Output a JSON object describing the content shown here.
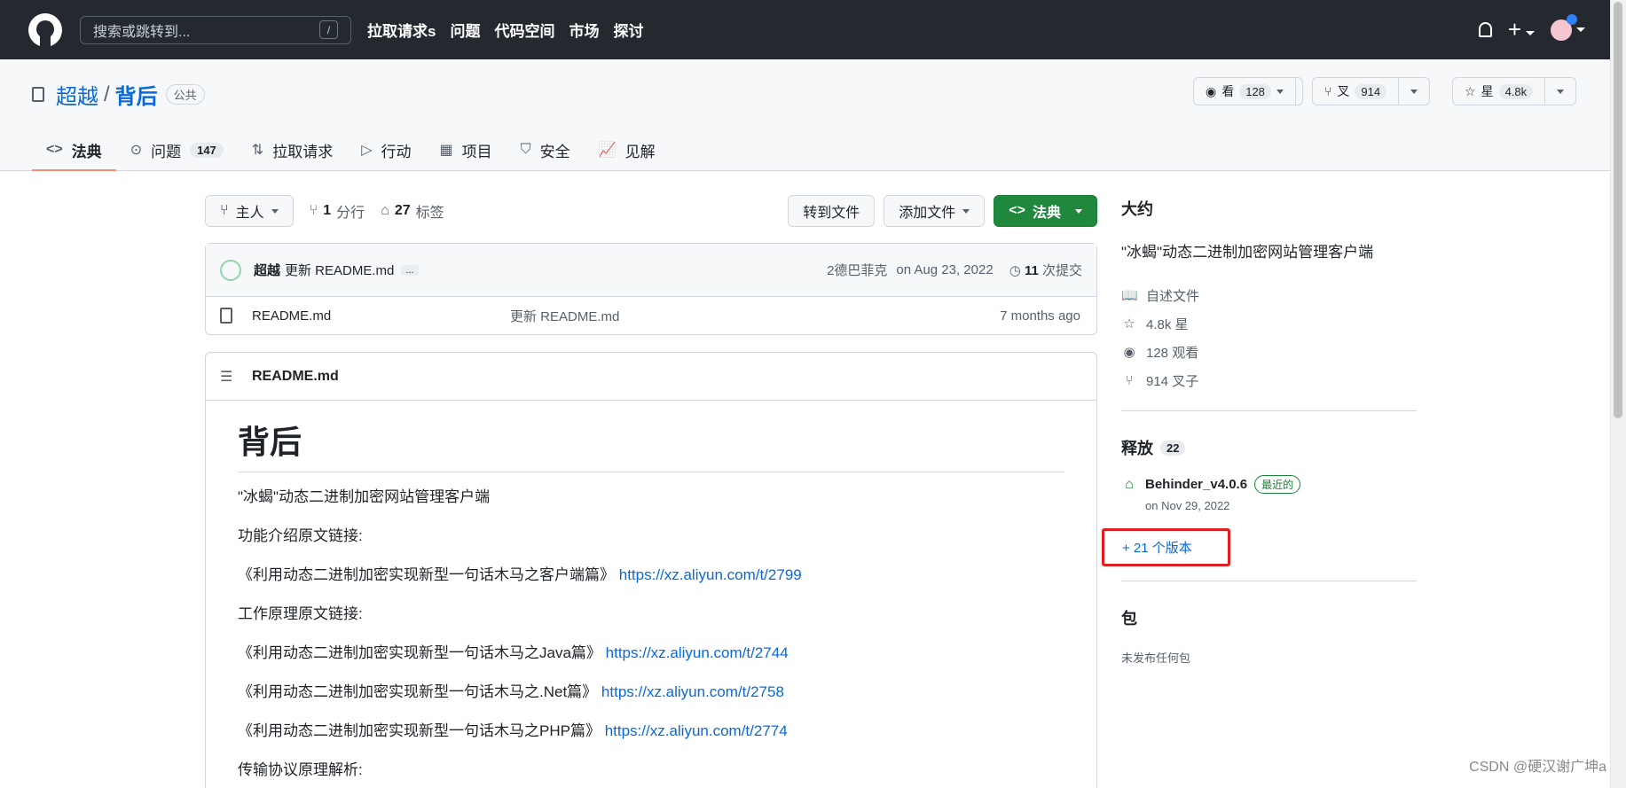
{
  "topbar": {
    "search_placeholder": "搜索或跳转到...",
    "slash": "/",
    "nav": [
      "拉取请求s",
      "问题",
      "代码空间",
      "市场",
      "探讨"
    ]
  },
  "repo": {
    "owner": "超越",
    "separator": "/",
    "name": "背后",
    "visibility": "公共",
    "watch_label": "看",
    "watch_count": "128",
    "fork_label": "叉",
    "fork_count": "914",
    "star_label": "星",
    "star_count": "4.8k"
  },
  "tabs": [
    {
      "label": "法典",
      "icon": "code-icon"
    },
    {
      "label": "问题",
      "count": "147",
      "icon": "issue-icon"
    },
    {
      "label": "拉取请求",
      "icon": "pull-request-icon"
    },
    {
      "label": "行动",
      "icon": "play-icon"
    },
    {
      "label": "项目",
      "icon": "table-icon"
    },
    {
      "label": "安全",
      "icon": "shield-icon"
    },
    {
      "label": "见解",
      "icon": "graph-icon"
    }
  ],
  "toolbar": {
    "branch": "主人",
    "branches_count": "1",
    "branches_label": "分行",
    "tags_count": "27",
    "tags_label": "标签",
    "goto_file": "转到文件",
    "add_file": "添加文件",
    "code": "法典"
  },
  "commit": {
    "author": "超越",
    "message": "更新 README.md",
    "more": "...",
    "hash": "2德巴菲克",
    "date": "on Aug 23, 2022",
    "commits_count": "11",
    "commits_label": "次提交"
  },
  "files": [
    {
      "name": "README.md",
      "message": "更新 README.md",
      "time": "7 months ago"
    }
  ],
  "readme": {
    "filename": "README.md",
    "title": "背后",
    "paragraphs": [
      "\"冰蝎\"动态二进制加密网站管理客户端",
      "功能介绍原文链接:",
      {
        "text": "《利用动态二进制加密实现新型一句话木马之客户端篇》",
        "link": "https://xz.aliyun.com/t/2799"
      },
      "工作原理原文链接:",
      {
        "text": "《利用动态二进制加密实现新型一句话木马之Java篇》",
        "link": "https://xz.aliyun.com/t/2744"
      },
      {
        "text": "《利用动态二进制加密实现新型一句话木马之.Net篇》",
        "link": "https://xz.aliyun.com/t/2758"
      },
      {
        "text": "《利用动态二进制加密实现新型一句话木马之PHP篇》",
        "link": "https://xz.aliyun.com/t/2774"
      },
      "传输协议原理解析:"
    ]
  },
  "about": {
    "heading": "大约",
    "description": "\"冰蝎\"动态二进制加密网站管理客户端",
    "readme": "自述文件",
    "stars": "4.8k 星",
    "watching": "128 观看",
    "forks": "914 叉子"
  },
  "releases": {
    "heading": "释放",
    "count": "22",
    "latest_name": "Behinder_v4.0.6",
    "latest_badge": "最近的",
    "latest_date": "on Nov 29, 2022",
    "more": "+ 21 个版本"
  },
  "packages": {
    "heading": "包",
    "empty": "未发布任何包"
  },
  "watermark": "CSDN @硬汉谢广坤a"
}
